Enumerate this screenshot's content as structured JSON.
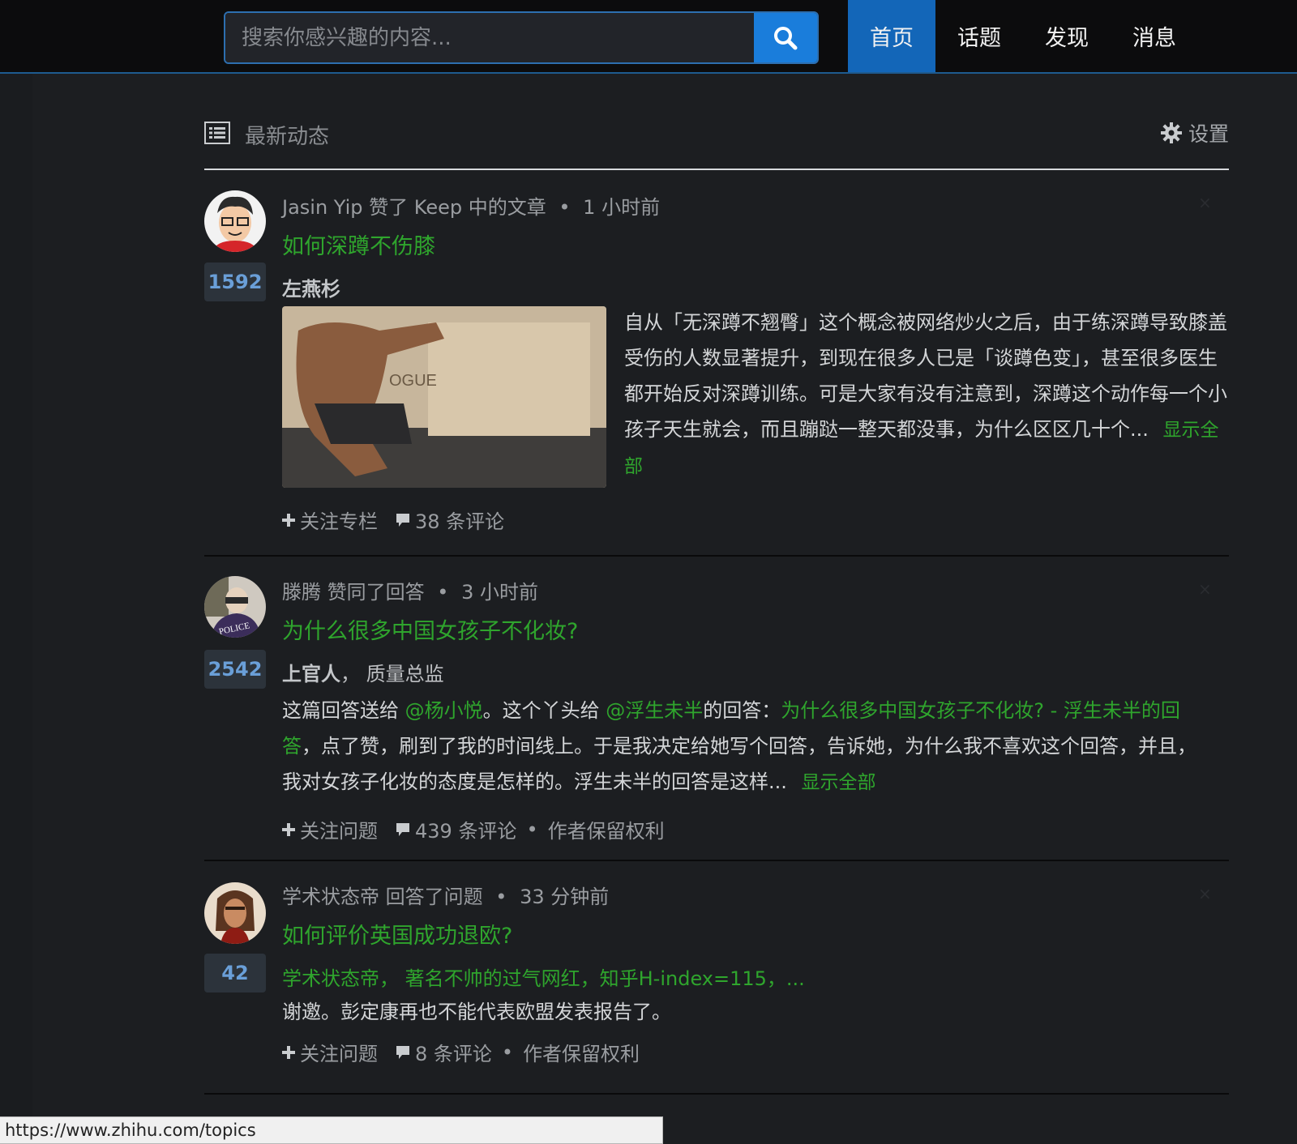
{
  "header": {
    "search_placeholder": "搜索你感兴趣的内容...",
    "nav": [
      {
        "label": "首页",
        "active": true
      },
      {
        "label": "话题",
        "active": false
      },
      {
        "label": "发现",
        "active": false
      },
      {
        "label": "消息",
        "active": false
      }
    ]
  },
  "feed": {
    "title": "最新动态",
    "settings_label": "设置",
    "items": [
      {
        "meta_user": "Jasin Yip",
        "meta_action": "赞了 Keep 中的文章",
        "meta_time": "1 小时前",
        "question": "如何深蹲不伤膝",
        "votes": "1592",
        "author": "左燕杉",
        "body": "自从「无深蹲不翘臀」这个概念被网络炒火之后，由于练深蹲导致膝盖受伤的人数显著提升，到现在很多人已是「谈蹲色变」，甚至很多医生都开始反对深蹲训练。可是大家有没有注意到，深蹲这个动作每一个小孩子天生就会，而且蹦跶一整天都没事，为什么区区几十个...",
        "show_all": "显示全部",
        "action1": "关注专栏",
        "comments": "38 条评论"
      },
      {
        "meta_user": "滕腾",
        "meta_action": "赞同了回答",
        "meta_time": "3 小时前",
        "question": "为什么很多中国女孩子不化妆?",
        "votes": "2542",
        "author": "上官人",
        "author_desc": "， 质量总监",
        "body_p1": "这篇回答送给 ",
        "body_link1": "@杨小悦",
        "body_p2": "。这个丫头给 ",
        "body_link2": "@浮生未半",
        "body_p3": "的回答：",
        "body_link3": "为什么很多中国女孩子不化妆? - 浮生未半的回答",
        "body_p4": "，点了赞，刷到了我的时间线上。于是我决定给她写个回答，告诉她，为什么我不喜欢这个回答，并且，我对女孩子化妆的态度是怎样的。浮生未半的回答是这样...",
        "show_all": "显示全部",
        "action1": "关注问题",
        "comments": "439 条评论",
        "rights": "作者保留权利"
      },
      {
        "meta_user": "学术状态帝",
        "meta_action": "回答了问题",
        "meta_time": "33 分钟前",
        "question": "如何评价英国成功退欧?",
        "votes": "42",
        "author": "学术状态帝",
        "author_desc": "， 著名不帅的过气网红，知乎H-index=115，...",
        "body": "谢邀。彭定康再也不能代表欧盟发表报告了。",
        "action1": "关注问题",
        "comments": "8 条评论",
        "rights": "作者保留权利"
      }
    ]
  },
  "statusbar": {
    "url": "https://www.zhihu.com/topics"
  },
  "colors": {
    "accent_blue": "#1366b8",
    "link_green": "#2fa52d",
    "background": "#1c1e21"
  },
  "icons": [
    "search-icon",
    "list-icon",
    "gear-icon",
    "plus-icon",
    "comment-icon",
    "close-icon"
  ]
}
